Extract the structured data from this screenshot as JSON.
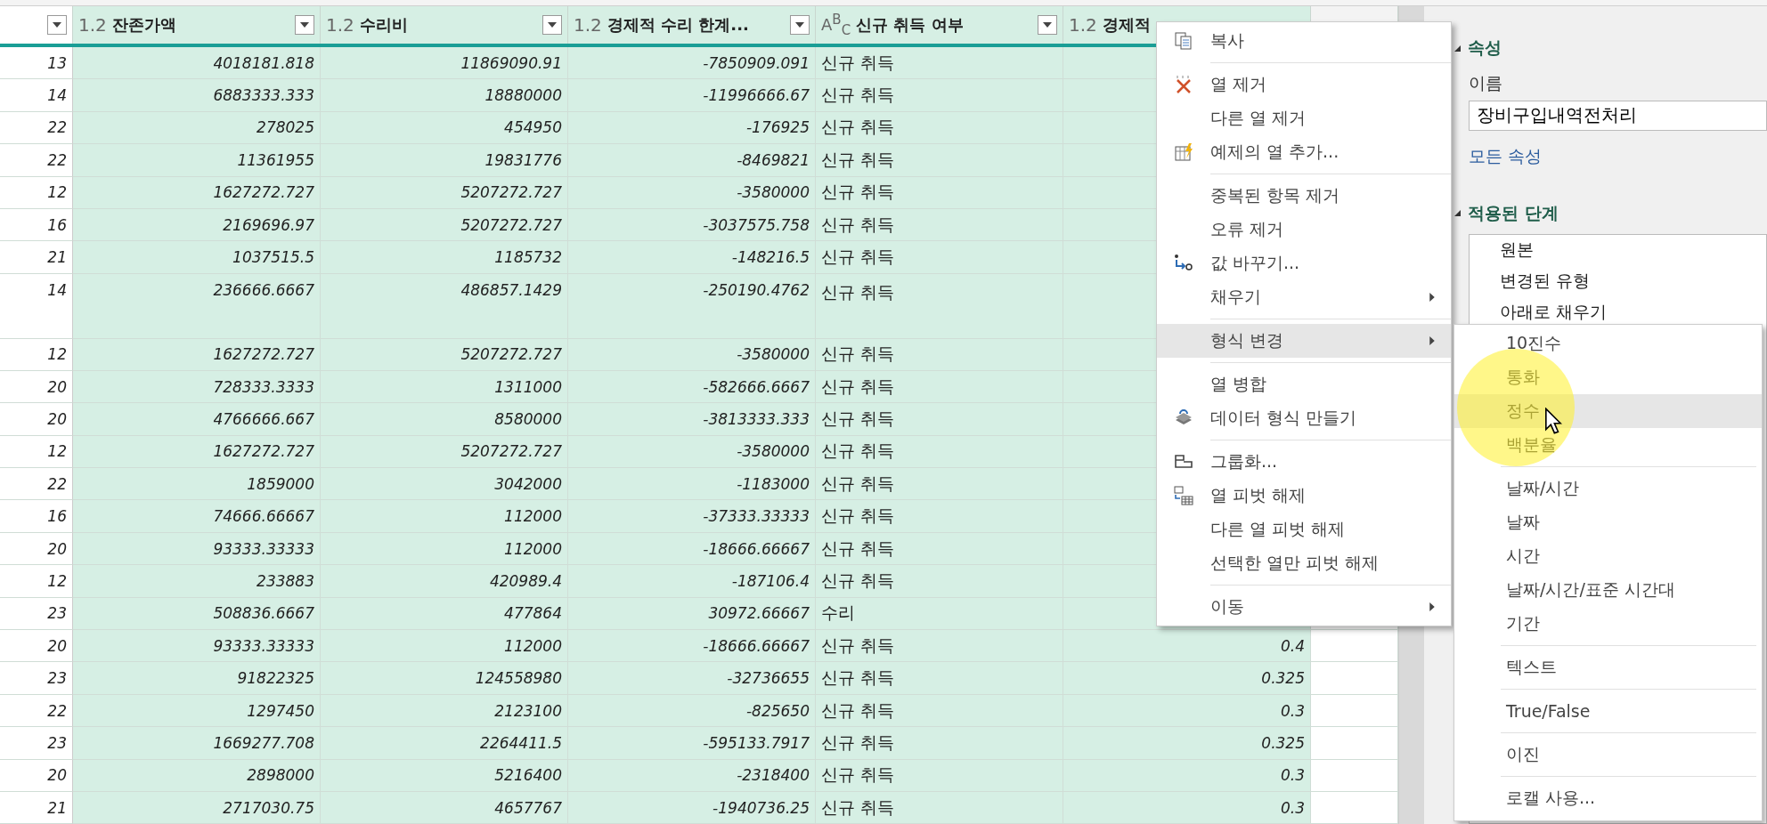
{
  "table": {
    "columns": [
      {
        "kind": "decimal",
        "type_label": "1.2",
        "title": "잔존가액",
        "selected": true
      },
      {
        "kind": "decimal",
        "type_label": "1.2",
        "title": "수리비",
        "selected": true
      },
      {
        "kind": "decimal",
        "type_label": "1.2",
        "title": "경제적 수리 한계...",
        "selected": true
      },
      {
        "kind": "text",
        "type_label": "A$^{B}$$_{C}$",
        "title": "신규 취득 여부",
        "selected": true
      },
      {
        "kind": "decimal",
        "type_label": "1.2",
        "title": "경제적",
        "selected": true
      }
    ],
    "rows": [
      {
        "index": "13",
        "cells": [
          "4018181.818",
          "11869090.91",
          "-7850909.091",
          "신규 취득"
        ]
      },
      {
        "index": "14",
        "cells": [
          "6883333.333",
          "18880000",
          "-11996666.67",
          "신규 취득"
        ]
      },
      {
        "index": "22",
        "cells": [
          "278025",
          "454950",
          "-176925",
          "신규 취득"
        ]
      },
      {
        "index": "22",
        "cells": [
          "11361955",
          "19831776",
          "-8469821",
          "신규 취득"
        ]
      },
      {
        "index": "12",
        "cells": [
          "1627272.727",
          "5207272.727",
          "-3580000",
          "신규 취득"
        ]
      },
      {
        "index": "16",
        "cells": [
          "2169696.97",
          "5207272.727",
          "-3037575.758",
          "신규 취득"
        ]
      },
      {
        "index": "21",
        "cells": [
          "1037515.5",
          "1185732",
          "-148216.5",
          "신규 취득"
        ]
      },
      {
        "index": "14",
        "kind": "tall",
        "cells": [
          "236666.6667",
          "486857.1429",
          "-250190.4762",
          "신규 취득"
        ]
      },
      {
        "index": "12",
        "cells": [
          "1627272.727",
          "5207272.727",
          "-3580000",
          "신규 취득"
        ]
      },
      {
        "index": "20",
        "cells": [
          "728333.3333",
          "1311000",
          "-582666.6667",
          "신규 취득"
        ]
      },
      {
        "index": "20",
        "cells": [
          "4766666.667",
          "8580000",
          "-3813333.333",
          "신규 취득"
        ]
      },
      {
        "index": "12",
        "cells": [
          "1627272.727",
          "5207272.727",
          "-3580000",
          "신규 취득"
        ]
      },
      {
        "index": "22",
        "cells": [
          "1859000",
          "3042000",
          "-1183000",
          "신규 취득"
        ]
      },
      {
        "index": "16",
        "cells": [
          "74666.66667",
          "112000",
          "-37333.33333",
          "신규 취득"
        ]
      },
      {
        "index": "20",
        "cells": [
          "93333.33333",
          "112000",
          "-18666.66667",
          "신규 취득"
        ]
      },
      {
        "index": "12",
        "cells": [
          "233883",
          "420989.4",
          "-187106.4",
          "신규 취득"
        ]
      },
      {
        "index": "23",
        "cells": [
          "508836.6667",
          "477864",
          "30972.66667",
          "수리"
        ]
      },
      {
        "index": "20",
        "cells": [
          "93333.33333",
          "112000",
          "-18666.66667",
          "신규 취득",
          "0.4"
        ]
      },
      {
        "index": "23",
        "cells": [
          "91822325",
          "124558980",
          "-32736655",
          "신규 취득",
          "0.325"
        ]
      },
      {
        "index": "22",
        "cells": [
          "1297450",
          "2123100",
          "-825650",
          "신규 취득",
          "0.3"
        ]
      },
      {
        "index": "23",
        "cells": [
          "1669277.708",
          "2264411.5",
          "-595133.7917",
          "신규 취득",
          "0.325"
        ]
      },
      {
        "index": "20",
        "cells": [
          "2898000",
          "5216400",
          "-2318400",
          "신규 취득",
          "0.3"
        ]
      },
      {
        "index": "21",
        "cells": [
          "2717030.75",
          "4657767",
          "-1940736.25",
          "신규 취득",
          "0.3"
        ]
      }
    ]
  },
  "context_menu": {
    "items": [
      {
        "kind": "copy",
        "label": "복사",
        "has_submenu": false,
        "selected": false
      },
      {
        "kind": "separator"
      },
      {
        "kind": "remove",
        "label": "열 제거",
        "has_submenu": false,
        "selected": false
      },
      {
        "kind": "plain",
        "label": "다른 열 제거",
        "has_submenu": false,
        "selected": false
      },
      {
        "kind": "example",
        "label": "예제의 열 추가...",
        "has_submenu": false,
        "selected": false
      },
      {
        "kind": "separator"
      },
      {
        "kind": "plain",
        "label": "중복된 항목 제거",
        "has_submenu": false,
        "selected": false
      },
      {
        "kind": "plain",
        "label": "오류 제거",
        "has_submenu": false,
        "selected": false
      },
      {
        "kind": "replace",
        "label": "값 바꾸기...",
        "has_submenu": false,
        "selected": false
      },
      {
        "kind": "plain",
        "label": "채우기",
        "has_submenu": true,
        "selected": false
      },
      {
        "kind": "separator"
      },
      {
        "kind": "plain",
        "label": "형식 변경",
        "has_submenu": true,
        "selected": true
      },
      {
        "kind": "separator"
      },
      {
        "kind": "plain",
        "label": "열 병합",
        "has_submenu": false,
        "selected": false
      },
      {
        "kind": "datatype",
        "label": "데이터 형식 만들기",
        "has_submenu": false,
        "selected": false
      },
      {
        "kind": "separator"
      },
      {
        "kind": "group",
        "label": "그룹화...",
        "has_submenu": false,
        "selected": false
      },
      {
        "kind": "unpivot",
        "label": "열 피벗 해제",
        "has_submenu": false,
        "selected": false
      },
      {
        "kind": "plain",
        "label": "다른 열 피벗 해제",
        "has_submenu": false,
        "selected": false
      },
      {
        "kind": "plain",
        "label": "선택한 열만 피벗 해제",
        "has_submenu": false,
        "selected": false
      },
      {
        "kind": "separator"
      },
      {
        "kind": "plain",
        "label": "이동",
        "has_submenu": true,
        "selected": false
      }
    ]
  },
  "submenu": {
    "items": [
      {
        "kind": "plain",
        "label": "10진수",
        "selected": false
      },
      {
        "kind": "plain",
        "label": "통화",
        "selected": false
      },
      {
        "kind": "plain",
        "label": "정수",
        "selected": true
      },
      {
        "kind": "plain",
        "label": "백분율",
        "selected": false
      },
      {
        "kind": "separator"
      },
      {
        "kind": "plain",
        "label": "날짜/시간",
        "selected": false
      },
      {
        "kind": "plain",
        "label": "날짜",
        "selected": false
      },
      {
        "kind": "plain",
        "label": "시간",
        "selected": false
      },
      {
        "kind": "plain",
        "label": "날짜/시간/표준 시간대",
        "selected": false
      },
      {
        "kind": "plain",
        "label": "기간",
        "selected": false
      },
      {
        "kind": "separator"
      },
      {
        "kind": "plain",
        "label": "텍스트",
        "selected": false
      },
      {
        "kind": "separator"
      },
      {
        "kind": "plain",
        "label": "True/False",
        "selected": false
      },
      {
        "kind": "separator"
      },
      {
        "kind": "plain",
        "label": "이진",
        "selected": false
      },
      {
        "kind": "separator"
      },
      {
        "kind": "plain",
        "label": "로캘 사용...",
        "selected": false
      }
    ]
  },
  "query_settings": {
    "properties_heading": "속성",
    "name_label": "이름",
    "name_value": "장비구입내역전처리",
    "all_properties_link": "모든 속성",
    "steps_heading": "적용된 단계",
    "steps": [
      {
        "label": "원본"
      },
      {
        "label": "변경된 유형"
      },
      {
        "label": "아래로 채우기"
      }
    ]
  }
}
